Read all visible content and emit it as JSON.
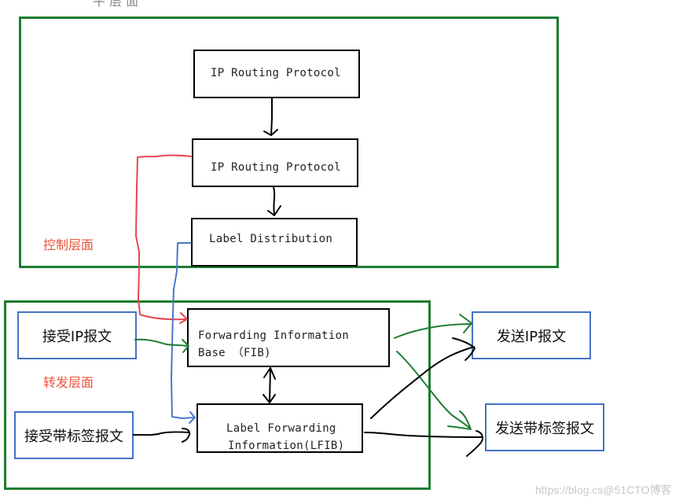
{
  "top_cut_text": "平 层 面",
  "control_plane": {
    "label": "控制层面",
    "boxes": {
      "ip_routing_protocol_1": "IP Routing Protocol",
      "ip_routing_protocol_2": "IP Routing Protocol",
      "label_distribution": "Label Distribution"
    }
  },
  "forwarding_plane": {
    "label": "转发层面",
    "fib": {
      "line1": "Forwarding Information",
      "line2": "Base （FIB)"
    },
    "lfib": {
      "line1": "Label Forwarding",
      "line2": "Information(LFIB)"
    },
    "receive_ip": "接受IP报文",
    "receive_labeled": "接受带标签报文"
  },
  "outputs": {
    "send_ip": "发送IP报文",
    "send_labeled": "发送带标签报文"
  },
  "colors": {
    "plane_border": "#1e7d32",
    "red_arrow": "#e8454f",
    "blue_arrow": "#4a78c8",
    "green_arrow": "#1e7d32",
    "black_arrow": "#000000",
    "plane_label": "#e8553a"
  },
  "watermark": "https://blog.cs@51CTO博客"
}
